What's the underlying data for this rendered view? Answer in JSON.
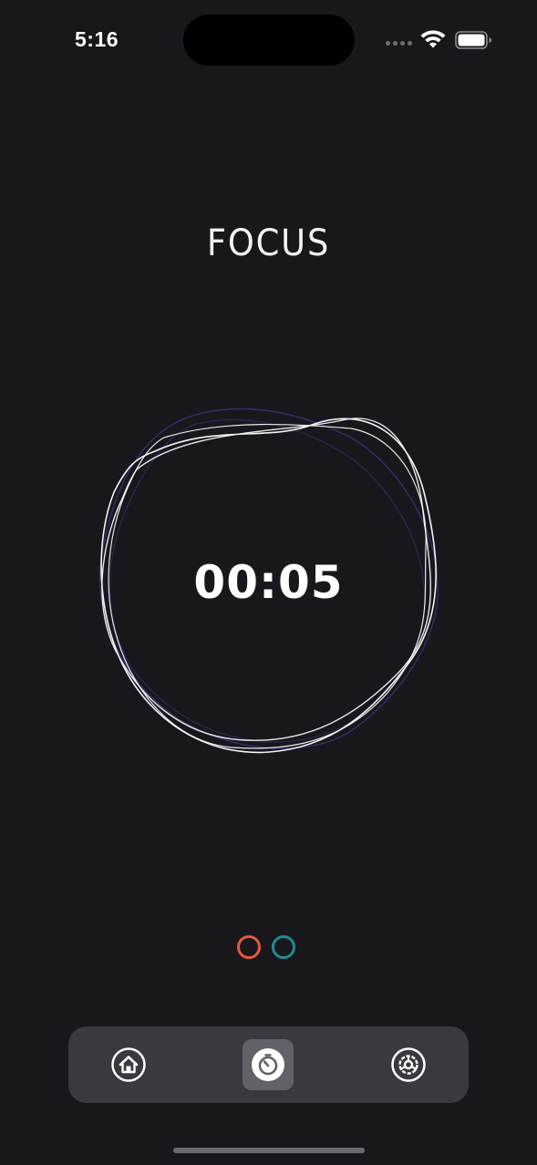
{
  "status_bar": {
    "time": "5:16",
    "icons": [
      "signal-dots",
      "wifi-icon",
      "battery-icon"
    ]
  },
  "screen": {
    "title": "FOCUS",
    "timer": "00:05"
  },
  "session_indicators": [
    {
      "name": "session-dot-1",
      "color": "#e4583c"
    },
    {
      "name": "session-dot-2",
      "color": "#1e8c94"
    }
  ],
  "tab_bar": {
    "items": [
      {
        "name": "tab-home",
        "icon": "home-icon",
        "active": false
      },
      {
        "name": "tab-timer",
        "icon": "timer-icon",
        "active": true
      },
      {
        "name": "tab-settings",
        "icon": "gear-icon",
        "active": false
      }
    ]
  },
  "colors": {
    "background": "#18171c",
    "ring_primary": "#f4f4f6",
    "ring_secondary": "#3b3a8f",
    "tab_bar": "#3a3940",
    "tab_active": "#626168"
  }
}
